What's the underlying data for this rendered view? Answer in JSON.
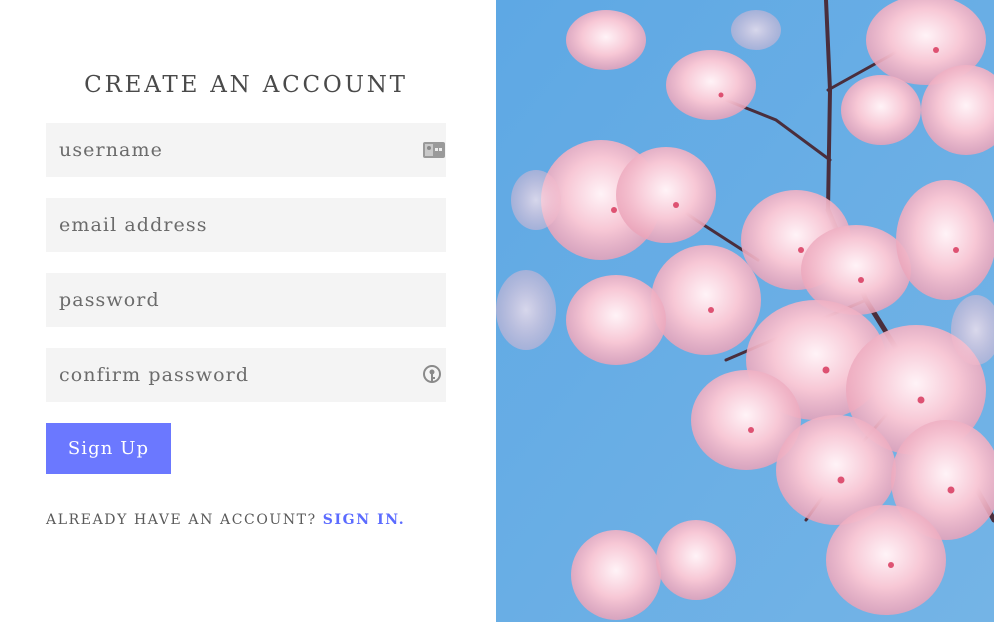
{
  "form": {
    "title": "CREATE AN ACCOUNT",
    "fields": [
      {
        "placeholder": "username",
        "icon": "contact-card-icon"
      },
      {
        "placeholder": "email address"
      },
      {
        "placeholder": "password"
      },
      {
        "placeholder": "confirm password",
        "icon": "password-key-icon"
      }
    ],
    "submit_label": "Sign Up",
    "signin_prompt": "ALREADY HAVE AN ACCOUNT?",
    "signin_link": "SIGN IN."
  },
  "hero_image": {
    "description": "pink cherry blossom branches against a blue sky"
  },
  "colors": {
    "accent": "#6b78ff",
    "link": "#5b6bff",
    "field_bg": "#f4f4f4",
    "sky": "#6aaee4",
    "blossom": "#f6c3d2"
  }
}
